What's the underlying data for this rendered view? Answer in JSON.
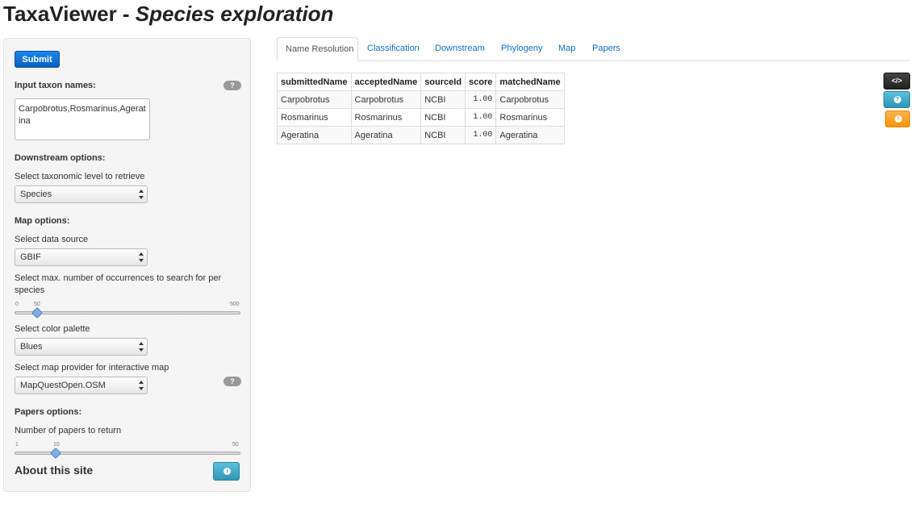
{
  "header": {
    "title_plain": "TaxaViewer - ",
    "title_italic": "Species exploration"
  },
  "sidebar": {
    "submit_label": "Submit",
    "input_label": "Input taxon names:",
    "input_value": "Carpobrotus,Rosmarinus,Ageratina",
    "downstream_heading": "Downstream options:",
    "taxonomic_level_label": "Select taxonomic level to retrieve",
    "taxonomic_level_value": "Species",
    "map_heading": "Map options:",
    "data_source_label": "Select data source",
    "data_source_value": "GBIF",
    "occurrences_label_line1": "Select max. number of occurrences to search for per",
    "occurrences_label_line2": "species",
    "occurrences_slider": {
      "min": "0",
      "max": "500",
      "value": "50",
      "fraction": 0.1
    },
    "palette_label": "Select color palette",
    "palette_value": "Blues",
    "provider_label": "Select map provider for interactive map",
    "provider_value": "MapQuestOpen.OSM",
    "papers_heading": "Papers options:",
    "papers_label": "Number of papers to return",
    "papers_slider": {
      "min": "1",
      "max": "50",
      "value": "10",
      "fraction": 0.1837
    },
    "about_label": "About this site",
    "help_glyph": "?",
    "info_glyph": "i"
  },
  "tabs": [
    {
      "label": "Name Resolution",
      "active": true
    },
    {
      "label": "Classification",
      "active": false
    },
    {
      "label": "Downstream",
      "active": false
    },
    {
      "label": "Phylogeny",
      "active": false
    },
    {
      "label": "Map",
      "active": false
    },
    {
      "label": "Papers",
      "active": false
    }
  ],
  "table": {
    "columns": [
      "submittedName",
      "acceptedName",
      "sourceId",
      "score",
      "matchedName"
    ],
    "rows": [
      [
        "Carpobrotus",
        "Carpobrotus",
        "NCBI",
        "1.00",
        "Carpobrotus"
      ],
      [
        "Rosmarinus",
        "Rosmarinus",
        "NCBI",
        "1.00",
        "Rosmarinus"
      ],
      [
        "Ageratina",
        "Ageratina",
        "NCBI",
        "1.00",
        "Ageratina"
      ]
    ]
  },
  "right_buttons": {
    "code_glyph": "</>",
    "help_glyph": "?",
    "warn_glyph": "!"
  },
  "colors": {
    "link": "#0f72c4",
    "primary": "#0b5fc2",
    "info": "#2f96b4",
    "warning": "#f89406"
  }
}
